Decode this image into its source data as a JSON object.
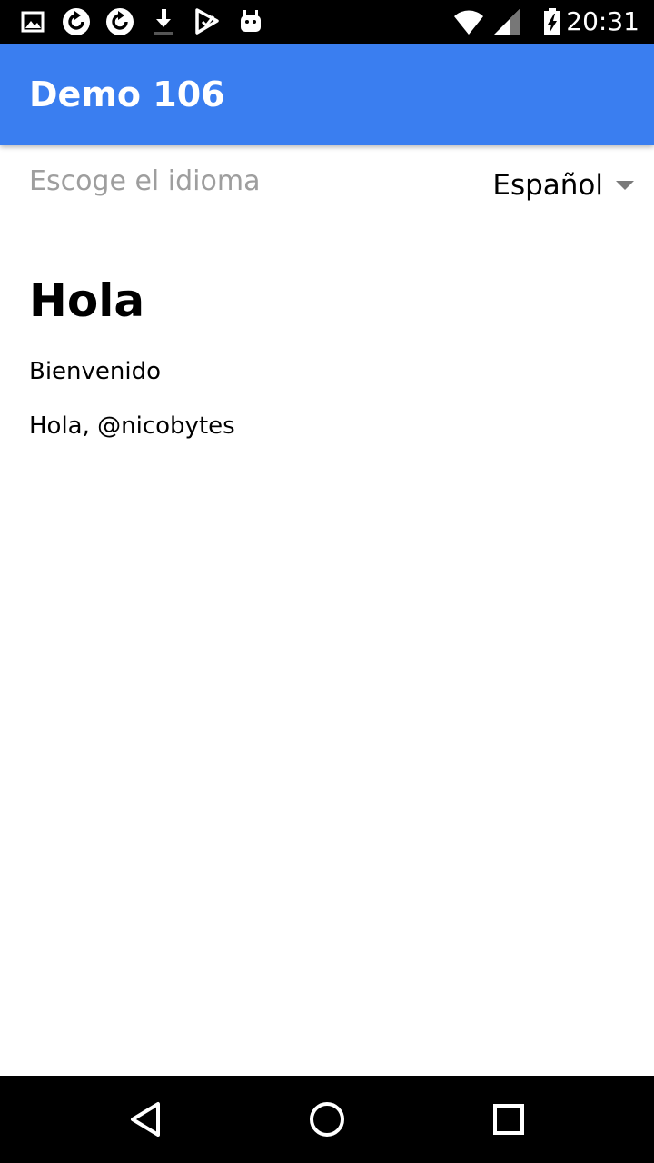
{
  "status_bar": {
    "time": "20:31",
    "left_icons": [
      "image-icon",
      "sync-icon",
      "sync-icon",
      "download-icon",
      "play-store-icon",
      "android-icon"
    ],
    "right_icons": [
      "wifi-icon",
      "signal-icon",
      "battery-charging-icon"
    ]
  },
  "app_bar": {
    "title": "Demo 106",
    "color": "#3A7EF0"
  },
  "language": {
    "label": "Escoge el idioma",
    "selected": "Español"
  },
  "content": {
    "heading": "Hola",
    "welcome": "Bienvenido",
    "greeting": "Hola, @nicobytes"
  },
  "nav_bar": {
    "buttons": [
      "back-icon",
      "home-icon",
      "recents-icon"
    ]
  }
}
